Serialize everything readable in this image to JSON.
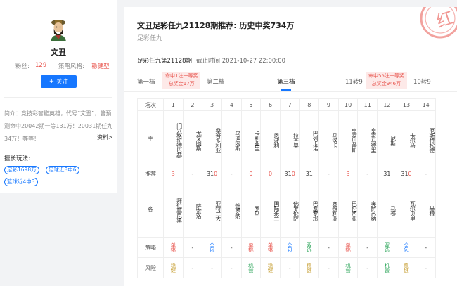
{
  "profile": {
    "name": "文丑",
    "fans_label": "粉丝:",
    "fans_value": "129",
    "style_label": "策略风格:",
    "style_value": "稳健型",
    "follow_label": "关注",
    "intro": "简介：竞技彩智能英雄，代号“文丑”，曾预测命中20042期一等131万！20031期任九34万！等等！",
    "more_label": "资料>",
    "skills_title": "擅长玩法:",
    "skills": [
      "足彩1698万",
      "足球近8中6",
      "篮球近4中3"
    ]
  },
  "article": {
    "title": "文丑足彩任九21128期推荐: 历史中奖734万",
    "subtitle": "足彩任九",
    "stamp_text": "红",
    "period": "足彩任九第21128期",
    "deadline": "截止时间 2021-10-27 22:00:00"
  },
  "tiers": {
    "t1": "第一档",
    "t1_prize_line1": "命中1注一等奖",
    "t1_prize_line2": "总奖金17万",
    "t2": "第二档",
    "t3": "第三档",
    "t4": "11转9",
    "t4_prize_line1": "命中55注一等奖",
    "t4_prize_line2": "总奖金946万",
    "t5": "10转9"
  },
  "table": {
    "row_labels": {
      "index": "场次",
      "home": "主",
      "rec": "推荐",
      "away": "客",
      "strategy": "策略",
      "risk": "风险"
    },
    "matches": [
      {
        "no": "1",
        "home": "门兴格拉德巴赫",
        "away": "拜仁慕尼黑",
        "rec": "3",
        "rec_color": "red",
        "strategy": "单挑",
        "strategy_color": "red",
        "risk": "稳健",
        "risk_color": "olive"
      },
      {
        "no": "2",
        "home": "尤文图斯",
        "away": "萨索洛",
        "rec": "-",
        "rec_color": "gray",
        "strategy": "-",
        "strategy_color": "gray",
        "risk": "-",
        "risk_color": "gray"
      },
      {
        "no": "3",
        "home": "桑普多利亚",
        "away": "亚特兰大",
        "rec": "310",
        "rec_color": "mix",
        "strategy": "全包",
        "strategy_color": "blue",
        "risk": "-",
        "risk_color": "gray"
      },
      {
        "no": "4",
        "home": "乌迪内斯",
        "away": "维罗纳",
        "rec": "-",
        "rec_color": "gray",
        "strategy": "-",
        "strategy_color": "gray",
        "risk": "-",
        "risk_color": "gray"
      },
      {
        "no": "5",
        "home": "卡利亚里",
        "away": "罗马",
        "rec": "0",
        "rec_color": "red",
        "strategy": "单挑",
        "strategy_color": "red",
        "risk": "机会",
        "risk_color": "green"
      },
      {
        "no": "6",
        "home": "恩波利",
        "away": "国际米兰",
        "rec": "0",
        "rec_color": "red",
        "strategy": "单挑",
        "strategy_color": "red",
        "risk": "稳健",
        "risk_color": "olive"
      },
      {
        "no": "7",
        "home": "拉齐奥",
        "away": "佛罗伦萨",
        "rec": "310",
        "rec_color": "mix",
        "strategy": "全包",
        "strategy_color": "blue",
        "risk": "-",
        "risk_color": "gray"
      },
      {
        "no": "8",
        "home": "巴列卡诺",
        "away": "巴塞罗那",
        "rec": "31",
        "rec_color": "mix",
        "strategy": "双选",
        "strategy_color": "green",
        "risk": "稳健",
        "risk_color": "olive"
      },
      {
        "no": "9",
        "home": "马洛卡",
        "away": "塞维利亚",
        "rec": "-",
        "rec_color": "gray",
        "strategy": "-",
        "strategy_color": "gray",
        "risk": "-",
        "risk_color": "gray"
      },
      {
        "no": "10",
        "home": "皇家贝蒂斯",
        "away": "巴伦西亚",
        "rec": "3",
        "rec_color": "red",
        "strategy": "单挑",
        "strategy_color": "red",
        "risk": "机会",
        "risk_color": "green"
      },
      {
        "no": "11",
        "home": "皇家马德里",
        "away": "奥萨苏纳",
        "rec": "-",
        "rec_color": "gray",
        "strategy": "-",
        "strategy_color": "gray",
        "risk": "-",
        "risk_color": "gray"
      },
      {
        "no": "12",
        "home": "尼斯",
        "away": "马赛",
        "rec": "31",
        "rec_color": "mix",
        "strategy": "双选",
        "strategy_color": "green",
        "risk": "机会",
        "risk_color": "green"
      },
      {
        "no": "13",
        "home": "卡尔马",
        "away": "瓦尔贝里",
        "rec": "310",
        "rec_color": "mix",
        "strategy": "全包",
        "strategy_color": "blue",
        "risk": "稳健",
        "risk_color": "olive"
      },
      {
        "no": "14",
        "home": "厄斯特松德",
        "away": "赫根",
        "rec": "-",
        "rec_color": "gray",
        "strategy": "-",
        "strategy_color": "gray",
        "risk": "-",
        "risk_color": "gray"
      }
    ]
  },
  "colors": {
    "accent": "#1677ff",
    "red": "#e8554e",
    "green": "#2ca55a",
    "olive": "#c8a23a"
  }
}
